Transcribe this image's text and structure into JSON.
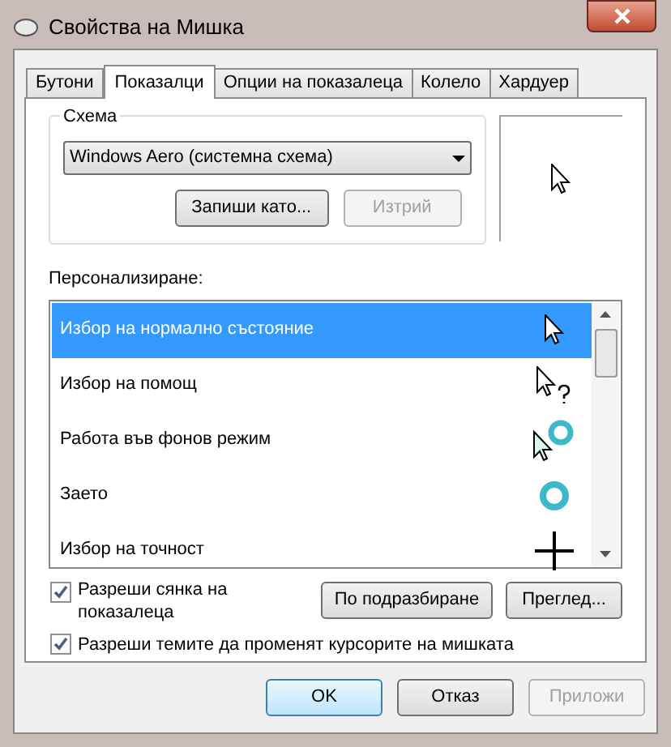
{
  "window": {
    "title": "Свойства на Мишка"
  },
  "tabs": [
    {
      "label": "Бутони",
      "selected": false
    },
    {
      "label": "Показалци",
      "selected": true
    },
    {
      "label": "Опции на показалеца",
      "selected": false
    },
    {
      "label": "Колело",
      "selected": false
    },
    {
      "label": "Хардуер",
      "selected": false
    }
  ],
  "scheme": {
    "label": "Схема",
    "value": "Windows Aero (системна схема)",
    "buttons": [
      {
        "label": "Запиши като...",
        "disabled": false
      },
      {
        "label": "Изтрий",
        "disabled": true
      }
    ]
  },
  "customize": {
    "label": "Персонализиране:",
    "items": [
      {
        "label": "Избор на нормално състояние",
        "kind": "arrow",
        "selected": true
      },
      {
        "label": "Избор на помощ",
        "kind": "help",
        "selected": false
      },
      {
        "label": "Работа във фонов режим",
        "kind": "working",
        "selected": false
      },
      {
        "label": "Заето",
        "kind": "busy",
        "selected": false
      },
      {
        "label": "Избор на точност",
        "kind": "precision",
        "selected": false
      }
    ]
  },
  "shadow": {
    "label": "Разреши сянка на показалеца",
    "checked": true
  },
  "buttons_row": [
    {
      "label": "По подразбиране"
    },
    {
      "label": "Преглед..."
    }
  ],
  "themes": {
    "label": "Разреши темите да променят курсорите на мишката",
    "checked": true
  },
  "footer": [
    {
      "label": "OK",
      "default": true,
      "disabled": false
    },
    {
      "label": "Отказ",
      "default": false,
      "disabled": false
    },
    {
      "label": "Приложи",
      "default": false,
      "disabled": true
    }
  ]
}
